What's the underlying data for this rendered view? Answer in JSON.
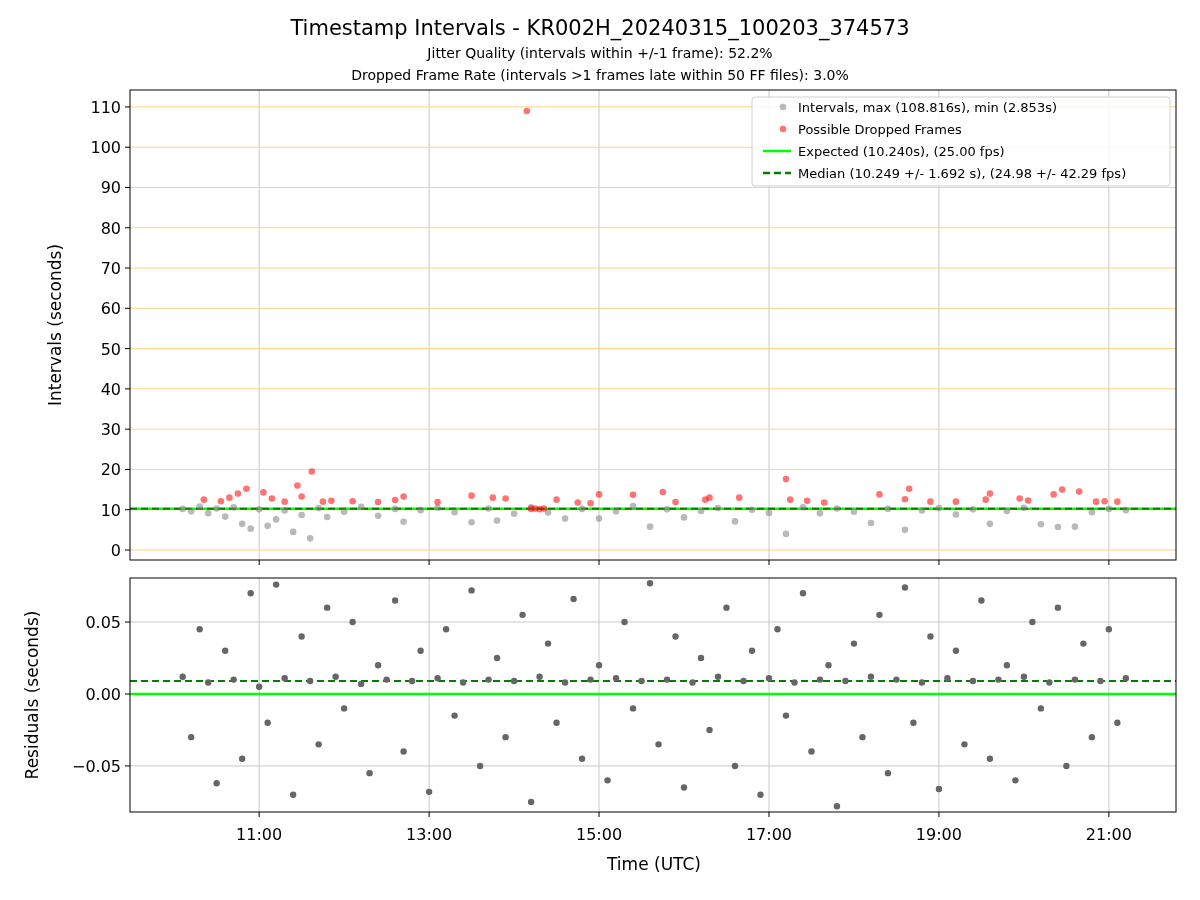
{
  "title": "Timestamp Intervals - KR002H_20240315_100203_374573",
  "subtitles": [
    "Jitter Quality (intervals within +/-1 frame): 52.2%",
    "Dropped Frame Rate (intervals >1 frames late within 50 FF files): 3.0%"
  ],
  "plots": [
    {
      "chart_data": {
        "type": "scatter",
        "ylabel": "Intervals (seconds)",
        "xlim": [
          9.48,
          21.79
        ],
        "ylim": [
          -2.48,
          114.2
        ],
        "grid": true,
        "legend": "upper right",
        "yticks": [
          {
            "value": 0,
            "label": "0"
          },
          {
            "value": 10,
            "label": "10"
          },
          {
            "value": 20,
            "label": "20"
          },
          {
            "value": 30,
            "label": "30"
          },
          {
            "value": 40,
            "label": "40"
          },
          {
            "value": 50,
            "label": "50"
          },
          {
            "value": 60,
            "label": "60"
          },
          {
            "value": 70,
            "label": "70"
          },
          {
            "value": 80,
            "label": "80"
          },
          {
            "value": 90,
            "label": "90"
          },
          {
            "value": 100,
            "label": "100"
          },
          {
            "value": 110,
            "label": "110"
          }
        ],
        "series": [
          {
            "name": "Intervals, max (108.816s), min (2.853s)",
            "color": "#808080",
            "x": [
              10.1,
              10.2,
              10.3,
              10.4,
              10.5,
              10.6,
              10.7,
              10.8,
              10.9,
              11.0,
              11.1,
              11.2,
              11.3,
              11.4,
              11.5,
              11.6,
              11.7,
              11.8,
              12.0,
              12.2,
              12.4,
              12.6,
              12.7,
              12.9,
              13.1,
              13.3,
              13.5,
              13.7,
              13.8,
              14.0,
              14.2,
              14.4,
              14.6,
              14.8,
              15.0,
              15.2,
              15.4,
              15.6,
              15.8,
              16.0,
              16.2,
              16.4,
              16.6,
              16.8,
              17.0,
              17.2,
              17.4,
              17.6,
              17.8,
              18.0,
              18.2,
              18.4,
              18.6,
              18.8,
              19.0,
              19.2,
              19.4,
              19.6,
              19.8,
              20.0,
              20.2,
              20.4,
              20.6,
              20.8,
              21.0,
              21.2
            ],
            "values": [
              10.2,
              9.6,
              10.8,
              9.1,
              10.3,
              8.3,
              10.6,
              6.5,
              5.3,
              10.1,
              6.0,
              7.6,
              9.8,
              4.5,
              8.7,
              2.9,
              10.4,
              8.2,
              9.5,
              10.7,
              8.5,
              10.2,
              7.0,
              9.9,
              10.5,
              9.4,
              6.9,
              10.3,
              7.3,
              9.0,
              10.6,
              9.3,
              7.8,
              10.2,
              7.8,
              9.6,
              10.9,
              5.8,
              10.1,
              8.1,
              9.7,
              10.4,
              7.1,
              10.0,
              9.2,
              4.0,
              10.6,
              9.1,
              10.3,
              9.5,
              6.7,
              10.2,
              5.0,
              9.8,
              10.4,
              8.8,
              10.1,
              6.5,
              9.7,
              10.5,
              6.4,
              5.7,
              5.8,
              9.4,
              10.2,
              9.9
            ]
          },
          {
            "name": "Possible Dropped Frames",
            "color": "#ff0000",
            "x": [
              10.35,
              10.55,
              10.65,
              10.75,
              10.85,
              11.05,
              11.15,
              11.3,
              11.45,
              11.5,
              11.62,
              11.75,
              11.85,
              12.1,
              12.4,
              12.6,
              12.7,
              13.1,
              13.5,
              13.75,
              13.9,
              14.15,
              14.2,
              14.25,
              14.3,
              14.35,
              14.5,
              14.75,
              14.9,
              15.0,
              15.4,
              15.75,
              15.9,
              16.25,
              16.3,
              16.65,
              17.2,
              17.25,
              17.45,
              17.65,
              18.3,
              18.6,
              18.65,
              18.9,
              19.2,
              19.55,
              19.6,
              19.95,
              20.05,
              20.35,
              20.45,
              20.65,
              20.85,
              20.95,
              21.1
            ],
            "values": [
              12.5,
              12.1,
              13.0,
              14.0,
              15.2,
              14.3,
              12.8,
              12.0,
              16.0,
              13.3,
              19.5,
              12.0,
              12.2,
              12.1,
              11.9,
              12.4,
              13.3,
              11.9,
              13.5,
              13.0,
              12.8,
              109.0,
              10.2,
              10.3,
              10.1,
              10.3,
              12.5,
              11.8,
              11.6,
              13.8,
              13.7,
              14.4,
              11.9,
              12.5,
              13.0,
              13.0,
              17.6,
              12.5,
              12.2,
              11.8,
              13.8,
              12.6,
              15.2,
              12.0,
              12.0,
              12.5,
              14.0,
              12.8,
              12.3,
              13.8,
              15.0,
              14.5,
              12.0,
              12.1,
              12.0
            ]
          }
        ],
        "ref_lines": [
          {
            "axis": "y",
            "value": 10.24,
            "label": "Expected (10.240s), (25.00 fps)",
            "color": "#00ff00"
          },
          {
            "axis": "y",
            "value": 10.249,
            "label": "Median (10.249 +/- 1.692 s), (24.98 +/- 42.29 fps)",
            "color": "#008000"
          }
        ]
      }
    },
    {
      "chart_data": {
        "type": "scatter",
        "xlabel": "Time (UTC)",
        "ylabel": "Residuals (seconds)",
        "xlim": [
          9.48,
          21.79
        ],
        "ylim": [
          -0.082,
          0.0806
        ],
        "grid": true,
        "xticks": [
          {
            "value": 11,
            "label": "11:00"
          },
          {
            "value": 13,
            "label": "13:00"
          },
          {
            "value": 15,
            "label": "15:00"
          },
          {
            "value": 17,
            "label": "17:00"
          },
          {
            "value": 19,
            "label": "19:00"
          },
          {
            "value": 21,
            "label": "21:00"
          }
        ],
        "yticks": [
          {
            "value": -0.05,
            "label": "−0.05"
          },
          {
            "value": 0,
            "label": "0.00"
          },
          {
            "value": 0.05,
            "label": "0.05"
          }
        ],
        "series": [
          {
            "color": "#666666",
            "x": [
              10.1,
              10.2,
              10.3,
              10.4,
              10.5,
              10.6,
              10.7,
              10.8,
              10.9,
              11.0,
              11.1,
              11.2,
              11.3,
              11.4,
              11.5,
              11.6,
              11.7,
              11.8,
              11.9,
              12.0,
              12.1,
              12.2,
              12.3,
              12.4,
              12.5,
              12.6,
              12.7,
              12.8,
              12.9,
              13.0,
              13.1,
              13.2,
              13.3,
              13.4,
              13.5,
              13.6,
              13.7,
              13.8,
              13.9,
              14.0,
              14.1,
              14.2,
              14.3,
              14.4,
              14.5,
              14.6,
              14.7,
              14.8,
              14.9,
              15.0,
              15.1,
              15.2,
              15.3,
              15.4,
              15.5,
              15.6,
              15.7,
              15.8,
              15.9,
              16.0,
              16.1,
              16.2,
              16.3,
              16.4,
              16.5,
              16.6,
              16.7,
              16.8,
              16.9,
              17.0,
              17.1,
              17.2,
              17.3,
              17.4,
              17.5,
              17.6,
              17.7,
              17.8,
              17.9,
              18.0,
              18.1,
              18.2,
              18.3,
              18.4,
              18.5,
              18.6,
              18.7,
              18.8,
              18.9,
              19.0,
              19.1,
              19.2,
              19.3,
              19.4,
              19.5,
              19.6,
              19.7,
              19.8,
              19.9,
              20.0,
              20.1,
              20.2,
              20.3,
              20.4,
              20.5,
              20.6,
              20.7,
              20.8,
              20.9,
              21.0,
              21.1,
              21.2
            ],
            "values": [
              0.012,
              -0.03,
              0.045,
              0.008,
              -0.062,
              0.03,
              0.01,
              -0.045,
              0.07,
              0.005,
              -0.02,
              0.076,
              0.011,
              -0.07,
              0.04,
              0.009,
              -0.035,
              0.06,
              0.012,
              -0.01,
              0.05,
              0.007,
              -0.055,
              0.02,
              0.01,
              0.065,
              -0.04,
              0.009,
              0.03,
              -0.068,
              0.011,
              0.045,
              -0.015,
              0.008,
              0.072,
              -0.05,
              0.01,
              0.025,
              -0.03,
              0.009,
              0.055,
              -0.075,
              0.012,
              0.035,
              -0.02,
              0.008,
              0.066,
              -0.045,
              0.01,
              0.02,
              -0.06,
              0.011,
              0.05,
              -0.01,
              0.009,
              0.077,
              -0.035,
              0.01,
              0.04,
              -0.065,
              0.008,
              0.025,
              -0.025,
              0.012,
              0.06,
              -0.05,
              0.009,
              0.03,
              -0.07,
              0.011,
              0.045,
              -0.015,
              0.008,
              0.07,
              -0.04,
              0.01,
              0.02,
              -0.078,
              0.009,
              0.035,
              -0.03,
              0.012,
              0.055,
              -0.055,
              0.01,
              0.074,
              -0.02,
              0.008,
              0.04,
              -0.066,
              0.011,
              0.03,
              -0.035,
              0.009,
              0.065,
              -0.045,
              0.01,
              0.02,
              -0.06,
              0.012,
              0.05,
              -0.01,
              0.008,
              0.06,
              -0.05,
              0.01,
              0.035,
              -0.03,
              0.009,
              0.045,
              -0.02,
              0.011
            ]
          }
        ],
        "ref_lines": [
          {
            "axis": "y",
            "value": 0,
            "color": "#00ff00"
          },
          {
            "axis": "y",
            "value": 0.009,
            "color": "#008000"
          }
        ]
      }
    }
  ]
}
